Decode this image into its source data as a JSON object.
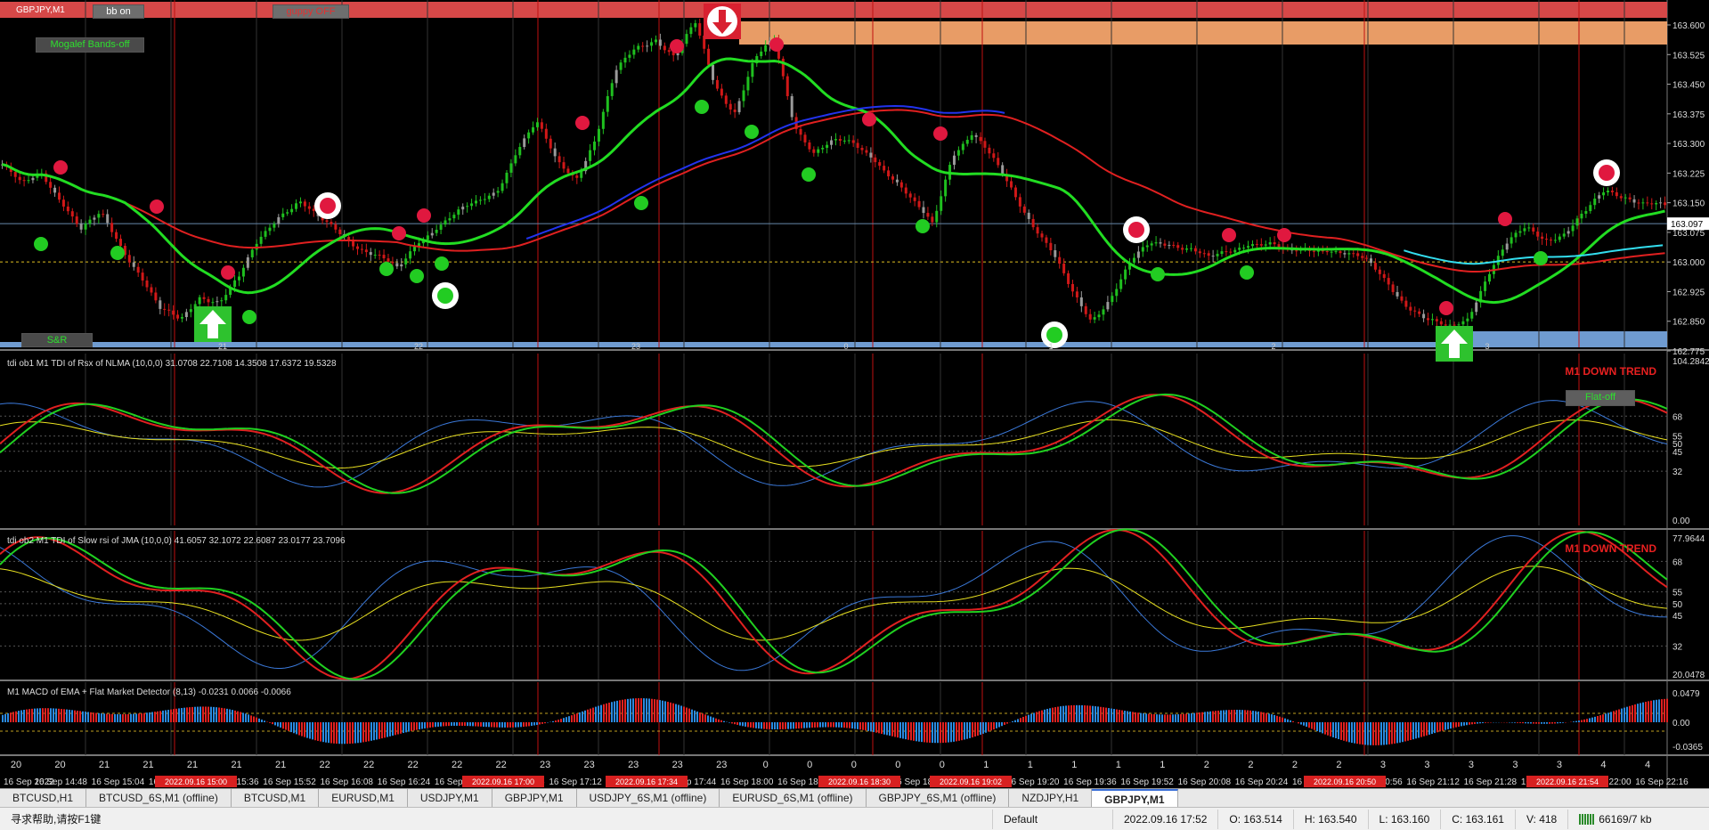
{
  "window_title": "GBPJPY,M1",
  "controls": {
    "bb_on": "bb on",
    "guppy_off": "guppy OFF",
    "mogalef": "Mogalef Bands-off",
    "sr": "S&R",
    "flat_off": "Flat-off"
  },
  "colors": {
    "bg": "#000000",
    "bull": "#1fbf1f",
    "bear": "#d01818",
    "gray": "#9a9a9a",
    "band": "#22dd22",
    "red_ma": "#e02020",
    "blue_ma": "#2233ee",
    "cyan_ma": "#33ddee",
    "signal_red": "#e0183f",
    "signal_green": "#22cc22",
    "resistance_zone": "#f4a46c",
    "support_zone": "#6f9bd0",
    "top_bar": "#d64848"
  },
  "price_panel": {
    "current_price": "163.097",
    "price_axis": [
      "163.600",
      "163.525",
      "163.450",
      "163.375",
      "163.300",
      "163.225",
      "163.150",
      "163.075",
      "163.000",
      "162.925",
      "162.850",
      "162.775"
    ],
    "candle_path": [
      163.24,
      163.18,
      163.22,
      163.16,
      163.08,
      163.12,
      163.05,
      162.98,
      162.88,
      162.85,
      162.92,
      162.9,
      162.95,
      163.05,
      163.12,
      163.15,
      163.1,
      163.08,
      163.05,
      163.02,
      162.98,
      163.06,
      163.1,
      163.12,
      163.14,
      163.18,
      163.28,
      163.34,
      163.25,
      163.22,
      163.32,
      163.48,
      163.55,
      163.58,
      163.52,
      163.6,
      163.45,
      163.38,
      163.5,
      163.55,
      163.35,
      163.28,
      163.3,
      163.3,
      163.28,
      163.22,
      163.15,
      163.1,
      163.28,
      163.32,
      163.25,
      163.18,
      163.1,
      163.02,
      162.92,
      162.86,
      162.92,
      163.0,
      163.05,
      163.06,
      163.04,
      163.0,
      163.02,
      163.05,
      163.04,
      163.01,
      163.03,
      163.04,
      163.02,
      163.0,
      162.96,
      162.9,
      162.85,
      162.83,
      162.86,
      162.96,
      163.03,
      163.08,
      163.06,
      163.07,
      163.12,
      163.19,
      163.18,
      163.15,
      163.14
    ],
    "flat_labels": [
      "21",
      "22",
      "23",
      "0",
      "1",
      "2",
      "3"
    ],
    "signals_up": 2,
    "signals_down": 1
  },
  "tdi1": {
    "title": "tdi ob1 M1 TDI of Rsx of NLMA (10,0,0) 31.0708 22.7108 14.3508 17.6372 19.5328",
    "trend": "M1 DOWN TREND",
    "axis": [
      "104.2842",
      "68",
      "55",
      "50",
      "45",
      "32",
      "0.00"
    ]
  },
  "tdi2": {
    "title": "tdi ob2 M1 TDI of Slow rsi of JMA (10,0,0) 41.6057 32.1072 22.6087 23.0177 23.7096",
    "trend": "M1 DOWN TREND",
    "axis": [
      "77.9644",
      "68",
      "55",
      "50",
      "45",
      "32",
      "20.0478"
    ]
  },
  "macd": {
    "title": "M1 MACD of EMA + Flat Market Detector (8,13) -0.0231 0.0066 -0.0066",
    "axis": [
      "0.0479",
      "0.00",
      "-0.0365"
    ]
  },
  "hour_labels": [
    "20",
    "20",
    "21",
    "21",
    "21",
    "21",
    "21",
    "22",
    "22",
    "22",
    "22",
    "22",
    "23",
    "23",
    "23",
    "23",
    "23",
    "0",
    "0",
    "0",
    "0",
    "0",
    "1",
    "1",
    "1",
    "1",
    "1",
    "2",
    "2",
    "2",
    "2",
    "3",
    "3",
    "3",
    "3",
    "3",
    "4",
    "4"
  ],
  "time_axis": [
    "16 Sep 2022",
    "16 Sep 14:48",
    "16 Sep 15:04",
    "16 Sep 15:20",
    "16 Sep 15:36",
    "16 Sep 15:52",
    "16 Sep 16:08",
    "16 Sep 16:24",
    "16 Sep 16:40",
    "16 Sep 16:56",
    "16 Sep 17:12",
    "16 Sep 17:28",
    "16 Sep 17:44",
    "16 Sep 18:00",
    "16 Sep 18:16",
    "16 Sep 18:32",
    "16 Sep 18:48",
    "16 Sep 19:04",
    "16 Sep 19:20",
    "16 Sep 19:36",
    "16 Sep 19:52",
    "16 Sep 20:08",
    "16 Sep 20:24",
    "16 Sep 20:40",
    "16 Sep 20:56",
    "16 Sep 21:12",
    "16 Sep 21:28",
    "16 Sep 21:44",
    "16 Sep 22:00",
    "16 Sep 22:16"
  ],
  "time_highlights": [
    "2022.09.16 15:00",
    "2022.09.16 17:00",
    "2022.09.16 17:34",
    "2022.09.16 18:30",
    "2022.09.16 19:02",
    "2022.09.16 20:50",
    "2022.09.16 21:54"
  ],
  "tabs": [
    "BTCUSD,H1",
    "BTCUSD_6S,M1 (offline)",
    "BTCUSD,M1",
    "EURUSD,M1",
    "USDJPY,M1",
    "GBPJPY,M1",
    "USDJPY_6S,M1 (offline)",
    "EURUSD_6S,M1 (offline)",
    "GBPJPY_6S,M1 (offline)",
    "NZDJPY,H1",
    "GBPJPY,M1"
  ],
  "active_tab": 10,
  "status": {
    "help": "寻求帮助,请按F1键",
    "profile": "Default",
    "datetime": "2022.09.16 17:52",
    "open": "O: 163.514",
    "high": "H: 163.540",
    "low": "L: 163.160",
    "close": "C: 163.161",
    "volume": "V: 418",
    "traffic": "66169/7 kb"
  }
}
